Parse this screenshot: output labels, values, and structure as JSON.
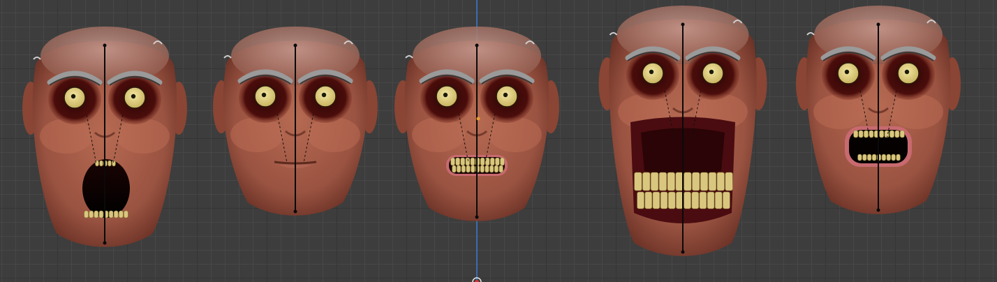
{
  "viewport": {
    "background": "#3d3d3d",
    "grid_minor": "#474747",
    "grid_major": "#353535",
    "axis_color": "#3a7fd6"
  },
  "skin": {
    "base": "#a35c47",
    "light": "#c8806a",
    "dark": "#5c2a1e",
    "socket": "#3a0a08"
  },
  "eye": {
    "sclera": "#e8d98a",
    "pupil": "#1a1a0a"
  },
  "teeth_color": "#d9c77f",
  "faces": [
    {
      "id": "face-1",
      "expression": "gasp"
    },
    {
      "id": "face-2",
      "expression": "neutral"
    },
    {
      "id": "face-3",
      "expression": "grimace"
    },
    {
      "id": "face-4",
      "expression": "scream"
    },
    {
      "id": "face-5",
      "expression": "shocked"
    }
  ]
}
